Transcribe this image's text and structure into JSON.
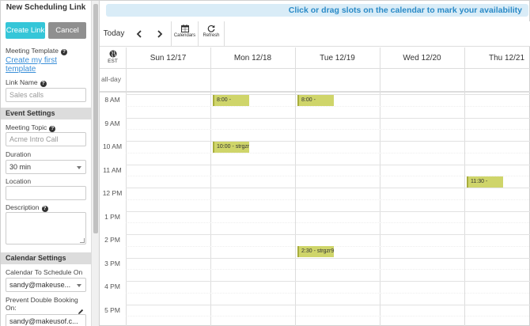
{
  "panel": {
    "title": "New Scheduling Link",
    "create_label": "Create Link",
    "cancel_label": "Cancel",
    "meeting_template_label": "Meeting Template",
    "meeting_template_link": "Create my first template",
    "link_name_label": "Link Name",
    "link_name_placeholder": "Sales calls",
    "event_settings_label": "Event Settings",
    "meeting_topic_label": "Meeting Topic",
    "meeting_topic_placeholder": "Acme Intro Call",
    "duration_label": "Duration",
    "duration_value": "30 min",
    "location_label": "Location",
    "location_value": "",
    "description_label": "Description",
    "description_value": "",
    "calendar_settings_label": "Calendar Settings",
    "calendar_to_schedule_label": "Calendar To Schedule On",
    "calendar_to_schedule_value": "sandy@makeuse...",
    "prevent_double_label": "Prevent Double Booking On:",
    "prevent_double_value": "sandy@makeusof.c..."
  },
  "banner_text": "Click or drag slots on the calendar to mark your availability",
  "toolbar": {
    "today_label": "Today",
    "prev_label": "‹",
    "next_label": "›",
    "calendars_label": "Calendars",
    "refresh_label": "Refresh"
  },
  "calendar": {
    "timezone": "EST",
    "allday_label": "all-day",
    "days": [
      "Sun 12/17",
      "Mon 12/18",
      "Tue 12/19",
      "Wed 12/20",
      "Thu 12/21"
    ],
    "hours": [
      "8 AM",
      "9 AM",
      "10 AM",
      "11 AM",
      "12 PM",
      "1 PM",
      "2 PM",
      "3 PM",
      "4 PM",
      "5 PM"
    ],
    "events": [
      {
        "day": 1,
        "hour": 8.0,
        "label": "8:00 -"
      },
      {
        "day": 2,
        "hour": 8.0,
        "label": "8:00 -"
      },
      {
        "day": 1,
        "hour": 10.0,
        "label": "10:00 - strgzr"
      },
      {
        "day": 4,
        "hour": 11.5,
        "label": "11:30 -"
      },
      {
        "day": 2,
        "hour": 14.5,
        "label": "2:30 - strgzr9"
      }
    ]
  },
  "colors": {
    "create_button": "#35c6d8",
    "cancel_button": "#8f8f8f",
    "event_fill": "#cfd56a",
    "banner_bg": "#d9ecf7",
    "banner_text": "#2a8ac7",
    "link": "#3a8fd8"
  }
}
